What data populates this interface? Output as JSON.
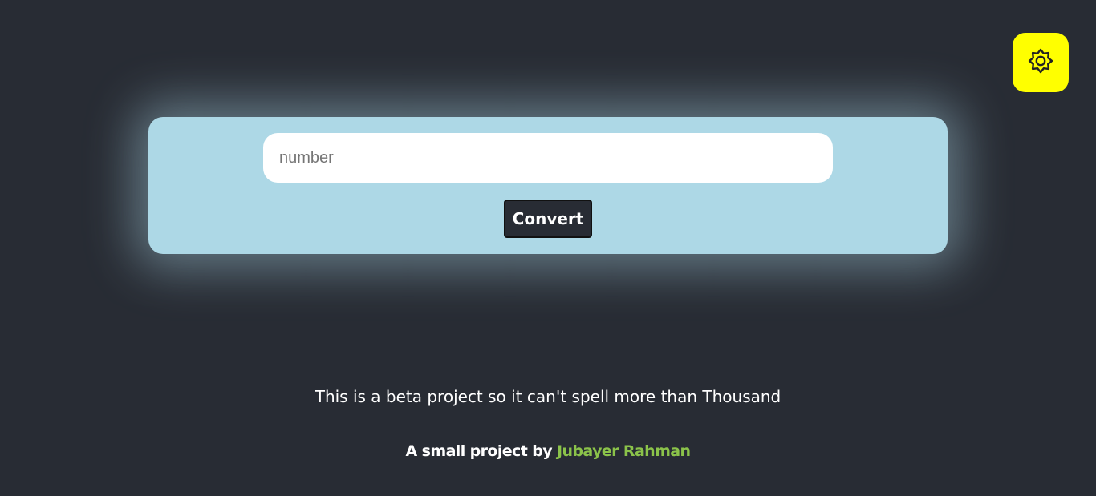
{
  "theme_toggle": {
    "icon": "gear-icon",
    "background": "#ffff00"
  },
  "converter": {
    "input_placeholder": "number",
    "input_value": "",
    "convert_label": "Convert",
    "card_color": "#add8e6"
  },
  "footer": {
    "beta_note": "This is a beta project so it can't spell more than Thousand",
    "credit_prefix": "A small project by",
    "author_name": "Jubayer Rahman",
    "author_color": "#8bc34a"
  },
  "colors": {
    "page_background": "#282c34",
    "text": "#ffffff"
  }
}
